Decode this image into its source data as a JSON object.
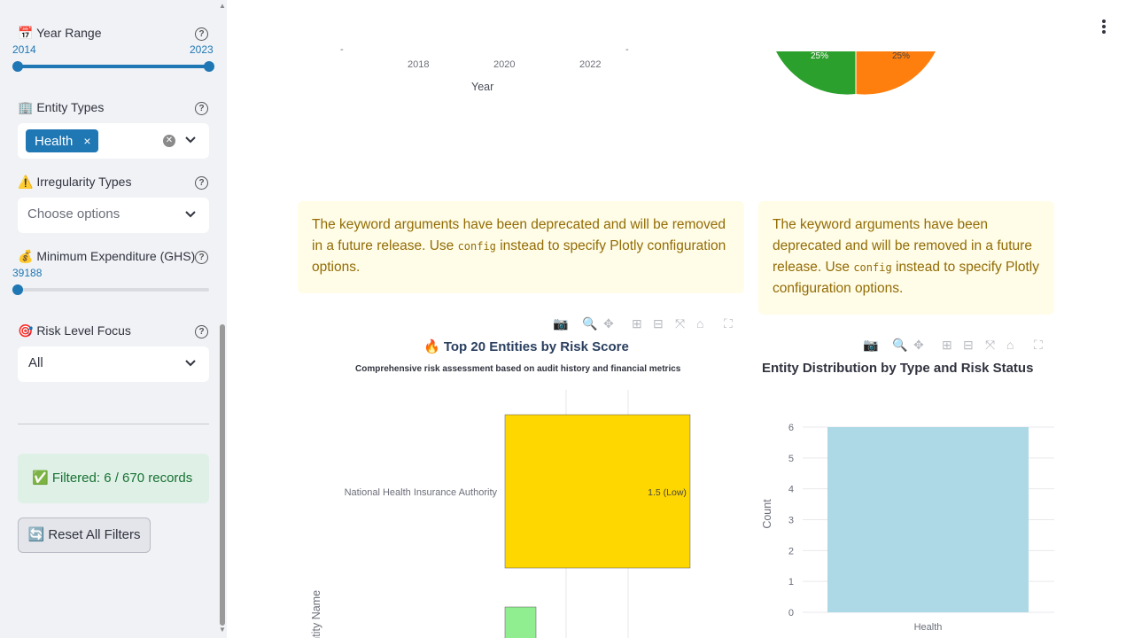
{
  "sidebar": {
    "year_range": {
      "label": "📅 Year Range",
      "min": "2014",
      "max": "2023",
      "min_fraction": 0.0,
      "max_fraction": 1.0
    },
    "entity_types": {
      "label": "🏢 Entity Types",
      "chip": "Health",
      "chip_remove": "×"
    },
    "irregularity_types": {
      "label": "⚠️ Irregularity Types",
      "placeholder": "Choose options"
    },
    "min_expenditure": {
      "label": "💰 Minimum Expenditure (GHS)",
      "value": "39188",
      "fraction": 0.0
    },
    "risk_level": {
      "label": "🎯 Risk Level Focus",
      "value": "All"
    },
    "filter_status": "✅ Filtered: 6 / 670 records",
    "reset_button": "🔄 Reset All Filters",
    "help_glyph": "?"
  },
  "top_partial": {
    "x_ticks": [
      "2018",
      "2020",
      "2022"
    ],
    "x_label": "Year",
    "pie_labels": [
      "25%",
      "25%"
    ],
    "pie_colors": [
      "#2ca02c",
      "#ff7f0e"
    ]
  },
  "warnings": {
    "left": {
      "pre": "The keyword arguments have been deprecated and will be removed in a future release. Use ",
      "code": "config",
      "post": " instead to specify Plotly configuration options."
    },
    "right": {
      "pre": "The keyword arguments have been deprecated and will be removed in a future release. Use ",
      "code": "config",
      "post": " instead to specify Plotly configuration options."
    }
  },
  "toolbar_icons": [
    "camera-icon",
    "zoom-icon",
    "pan-icon",
    "zoom-in-icon",
    "zoom-out-icon",
    "autoscale-icon",
    "reset-axes-icon",
    "fullscreen-icon"
  ],
  "chart_data": [
    {
      "type": "bar",
      "orientation": "horizontal",
      "title": "🔥 Top 20 Entities by Risk Score",
      "subtitle": "Comprehensive risk assessment based on audit history and financial metrics",
      "ylabel": "Entity Name",
      "categories": [
        "National Health Insurance Authority"
      ],
      "values": [
        1.5
      ],
      "data_labels": [
        "1.5 (Low)"
      ],
      "colors": [
        "#ffd700",
        "#90ee90"
      ]
    },
    {
      "type": "bar",
      "title": "Entity Distribution by Type and Risk Status",
      "xlabel": "",
      "ylabel": "Count",
      "categories": [
        "Health"
      ],
      "values": [
        6
      ],
      "y_ticks": [
        "0",
        "1",
        "2",
        "3",
        "4",
        "5",
        "6"
      ],
      "ylim": [
        0,
        6
      ],
      "grid": true,
      "color": "#add8e6"
    }
  ]
}
